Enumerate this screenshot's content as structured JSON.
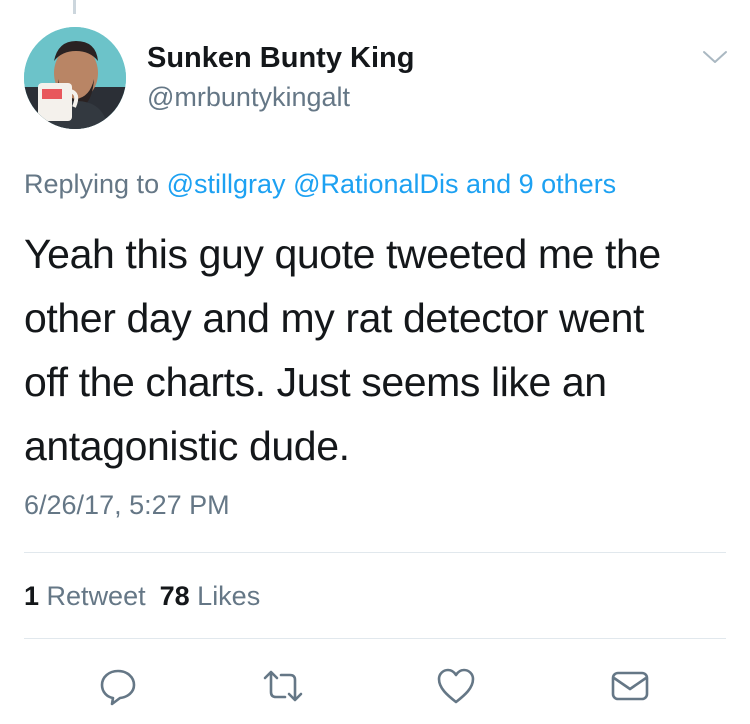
{
  "tweet": {
    "author": {
      "display_name": "Sunken Bunty King",
      "handle": "@mrbuntykingalt",
      "avatar_icon": "profile-photo-avatar"
    },
    "reply": {
      "prefix": "Replying to",
      "mentions": [
        "@stillgray",
        "@RationalDis"
      ],
      "connector": "and",
      "others": "9 others"
    },
    "text_lines": [
      "Yeah this guy quote tweeted me the",
      "other day and my rat detector went",
      "off the charts. Just seems like an",
      "antagonistic dude."
    ],
    "timestamp": "6/26/17, 5:27 PM",
    "stats": {
      "retweet_count": "1",
      "retweet_label": "Retweet",
      "like_count": "78",
      "like_label": "Likes"
    },
    "actions": [
      {
        "name": "reply",
        "icon": "speech-bubble-icon"
      },
      {
        "name": "retweet",
        "icon": "retweet-arrows-icon"
      },
      {
        "name": "like",
        "icon": "heart-icon"
      },
      {
        "name": "direct-message",
        "icon": "envelope-icon"
      }
    ]
  },
  "colors": {
    "text_primary": "#14171a",
    "text_secondary": "#657786",
    "link_blue": "#1da1f2",
    "divider": "#e1e8ed",
    "icon_gray": "#657786"
  }
}
